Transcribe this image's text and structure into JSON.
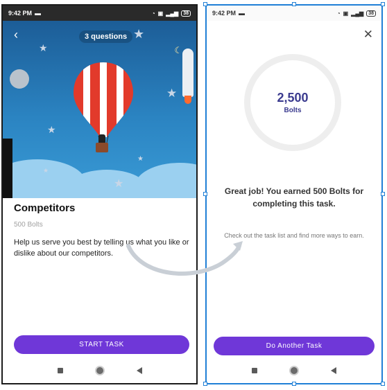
{
  "status": {
    "time": "9:42 PM",
    "battery": "38"
  },
  "left": {
    "hero": {
      "questions": "3 questions"
    },
    "task": {
      "title": "Competitors",
      "bolts": "500 Bolts",
      "description": "Help us serve you best by telling us what you like or dislike about our competitors."
    },
    "cta_label": "START TASK"
  },
  "right": {
    "ring_value": "2,500",
    "ring_unit": "Bolts",
    "message": "Great job! You earned 500 Bolts for completing this task.",
    "checkout": "Check out the task list and find more ways to earn.",
    "cta_label": "Do Another Task"
  },
  "colors": {
    "primary": "#6f37d8",
    "ring_text": "#3b3b8f",
    "selection": "#1f7fd6"
  },
  "icons": {
    "back": "back-arrow-icon",
    "close": "close-icon",
    "wifi": "wifi-icon",
    "signal": "signal-icon",
    "battery": "battery-icon"
  }
}
